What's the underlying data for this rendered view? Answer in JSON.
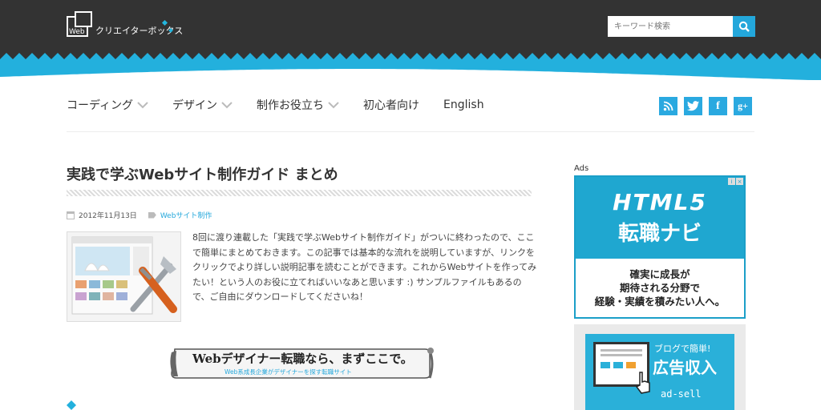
{
  "header": {
    "logo_web": "Web",
    "logo_text": "クリエイターボックス",
    "search_placeholder": "キーワード検索",
    "colors": {
      "dark": "#333333",
      "accent": "#23a7db"
    }
  },
  "nav": {
    "items": [
      {
        "label": "コーディング",
        "has_dropdown": true
      },
      {
        "label": "デザイン",
        "has_dropdown": true
      },
      {
        "label": "制作お役立ち",
        "has_dropdown": true
      },
      {
        "label": "初心者向け",
        "has_dropdown": false
      },
      {
        "label": "English",
        "has_dropdown": false
      }
    ],
    "social": [
      {
        "name": "rss-icon",
        "glyph": ""
      },
      {
        "name": "twitter-icon",
        "glyph": ""
      },
      {
        "name": "facebook-icon",
        "glyph": "f"
      },
      {
        "name": "google-plus-icon",
        "glyph": "g+"
      }
    ]
  },
  "article": {
    "title": "実践で学ぶWebサイト制作ガイド まとめ",
    "date": "2012年11月13日",
    "category": "Webサイト制作",
    "excerpt": "8回に渡り連載した「実践で学ぶWebサイト制作ガイド」がついに終わったので、ここで簡単にまとめておきます。この記事では基本的な流れを説明していますが、リンクをクリックでより詳しい説明記事を読むことができます。これからWebサイトを作ってみたい！という人のお役に立てればいいなあと思います :) サンプルファイルもあるので、ご自由にダウンロードしてくださいね！",
    "banner_main": "Webデザイナー転職なら、まずここで。",
    "banner_sub": "Web系成長企業がデザイナーを探す転職サイト"
  },
  "sidebar": {
    "ads_label": "Ads",
    "ad1": {
      "line1": "HTML5",
      "line2": "転職ナビ",
      "line3": "確実に成長が",
      "line4": "期待される分野で",
      "line5": "経験・実績を積みたい人へ。"
    },
    "ad2": {
      "line1": "ブログで簡単!",
      "line2": "広告収入",
      "line3": "ad-sell"
    }
  }
}
